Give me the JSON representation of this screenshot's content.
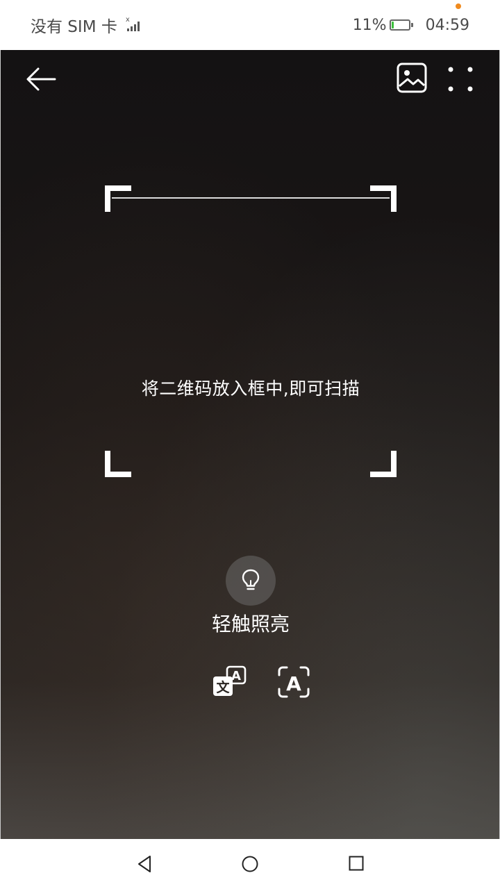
{
  "status_bar": {
    "carrier": "没有 SIM 卡",
    "battery": "11%",
    "battery_level": 0.11,
    "time": "04:59",
    "notification_dot_color": "#f08a1e"
  },
  "toolbar": {
    "back_icon": "arrow-left-icon",
    "gallery_icon": "image-gallery-icon",
    "more_icon": "more-dots-icon"
  },
  "scanner": {
    "hint": "将二维码放入框中,即可扫描"
  },
  "torch": {
    "icon": "lightbulb-icon",
    "label": "轻触照亮"
  },
  "modes": {
    "translate_icon": "translate-icon",
    "translate_glyph_a": "A",
    "translate_glyph_wen": "文",
    "ocr_icon": "text-recognition-icon",
    "ocr_glyph": "A"
  },
  "nav_bar": {
    "back_icon": "triangle-back-icon",
    "home_icon": "circle-home-icon",
    "recent_icon": "square-recent-icon"
  }
}
